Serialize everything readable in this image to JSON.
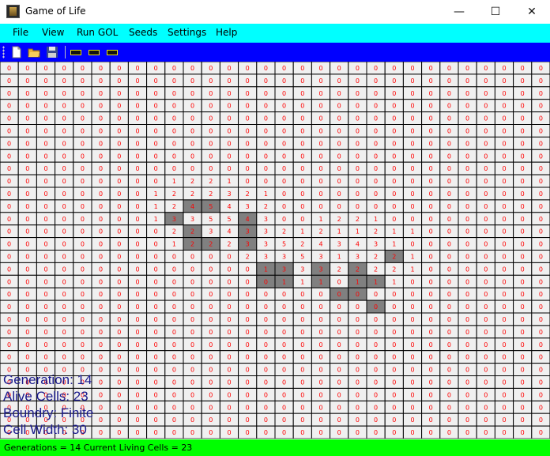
{
  "window": {
    "title": "Game of Life",
    "controls": {
      "minimize": "—",
      "maximize": "☐",
      "close": "✕"
    }
  },
  "menu": [
    "File",
    "View",
    "Run GOL",
    "Seeds",
    "Settings",
    "Help"
  ],
  "toolbar": {
    "icons": [
      "new-file-icon",
      "open-folder-icon",
      "save-disk-icon"
    ],
    "badges": [
      "play-badge-icon",
      "pause-badge-icon",
      "next-badge-icon"
    ]
  },
  "colors": {
    "menubar": "#00ffff",
    "toolbar": "#0000ff",
    "statusbar": "#00ff00",
    "neighbor_text": "#ff0000",
    "alive_cell": "#808080",
    "grid_line": "#000000",
    "cell_bg": "#f0f0f0",
    "overlay_text": "#1a1a8c"
  },
  "grid": {
    "rows": 30,
    "cols": 30,
    "alive": [
      [
        11,
        10
      ],
      [
        11,
        11
      ],
      [
        12,
        9
      ],
      [
        12,
        13
      ],
      [
        13,
        10
      ],
      [
        13,
        13
      ],
      [
        14,
        10
      ],
      [
        14,
        11
      ],
      [
        14,
        13
      ],
      [
        15,
        21
      ],
      [
        16,
        14
      ],
      [
        16,
        15
      ],
      [
        16,
        17
      ],
      [
        16,
        19
      ],
      [
        17,
        14
      ],
      [
        17,
        15
      ],
      [
        17,
        17
      ],
      [
        17,
        19
      ],
      [
        17,
        20
      ],
      [
        18,
        18
      ],
      [
        18,
        19
      ],
      [
        19,
        20
      ]
    ],
    "neighbor_counts": [
      "000000000000000000000000000000",
      "000000000000000000000000000000",
      "000000000000000000000000000000",
      "000000000000000000000000000000",
      "000000000000000000000000000000",
      "000000000000000000000000000000",
      "000000000000000000000000000000",
      "000000000000000000000000000000",
      "000000000000000000000000000000",
      "000000000122100000000000000000",
      "000000001222321000000000000000",
      "000000001245432000000000000000",
      "000000001335543001221000000000",
      "000000000223433212112110000000",
      "000000000122233524343100000000",
      "000000000000023353132210000000",
      "000000000000001333222210000000",
      "000000000000000111011100000000",
      "000000000000000000000000000000",
      "000000000000000000000000000000",
      "000000000000000000000000000000",
      "000000000000000000000000000000",
      "000000000000000000000000000000",
      "000000000000000000000000000000",
      "000000000000000000000000000000",
      "000000000000000000000000000000",
      "000000000000000000000000000000",
      "000000000000000000000000000000",
      "000000000000000000000000000000",
      "000000000000000000000000000000"
    ]
  },
  "overlay": {
    "generation": "Generation: 14",
    "alive": "Alive Cells: 23",
    "boundary": "Boundry: Finite",
    "cell_width": "Cell Width: 30"
  },
  "status": {
    "text": "Generations = 14  Current Living Cells = 23"
  }
}
